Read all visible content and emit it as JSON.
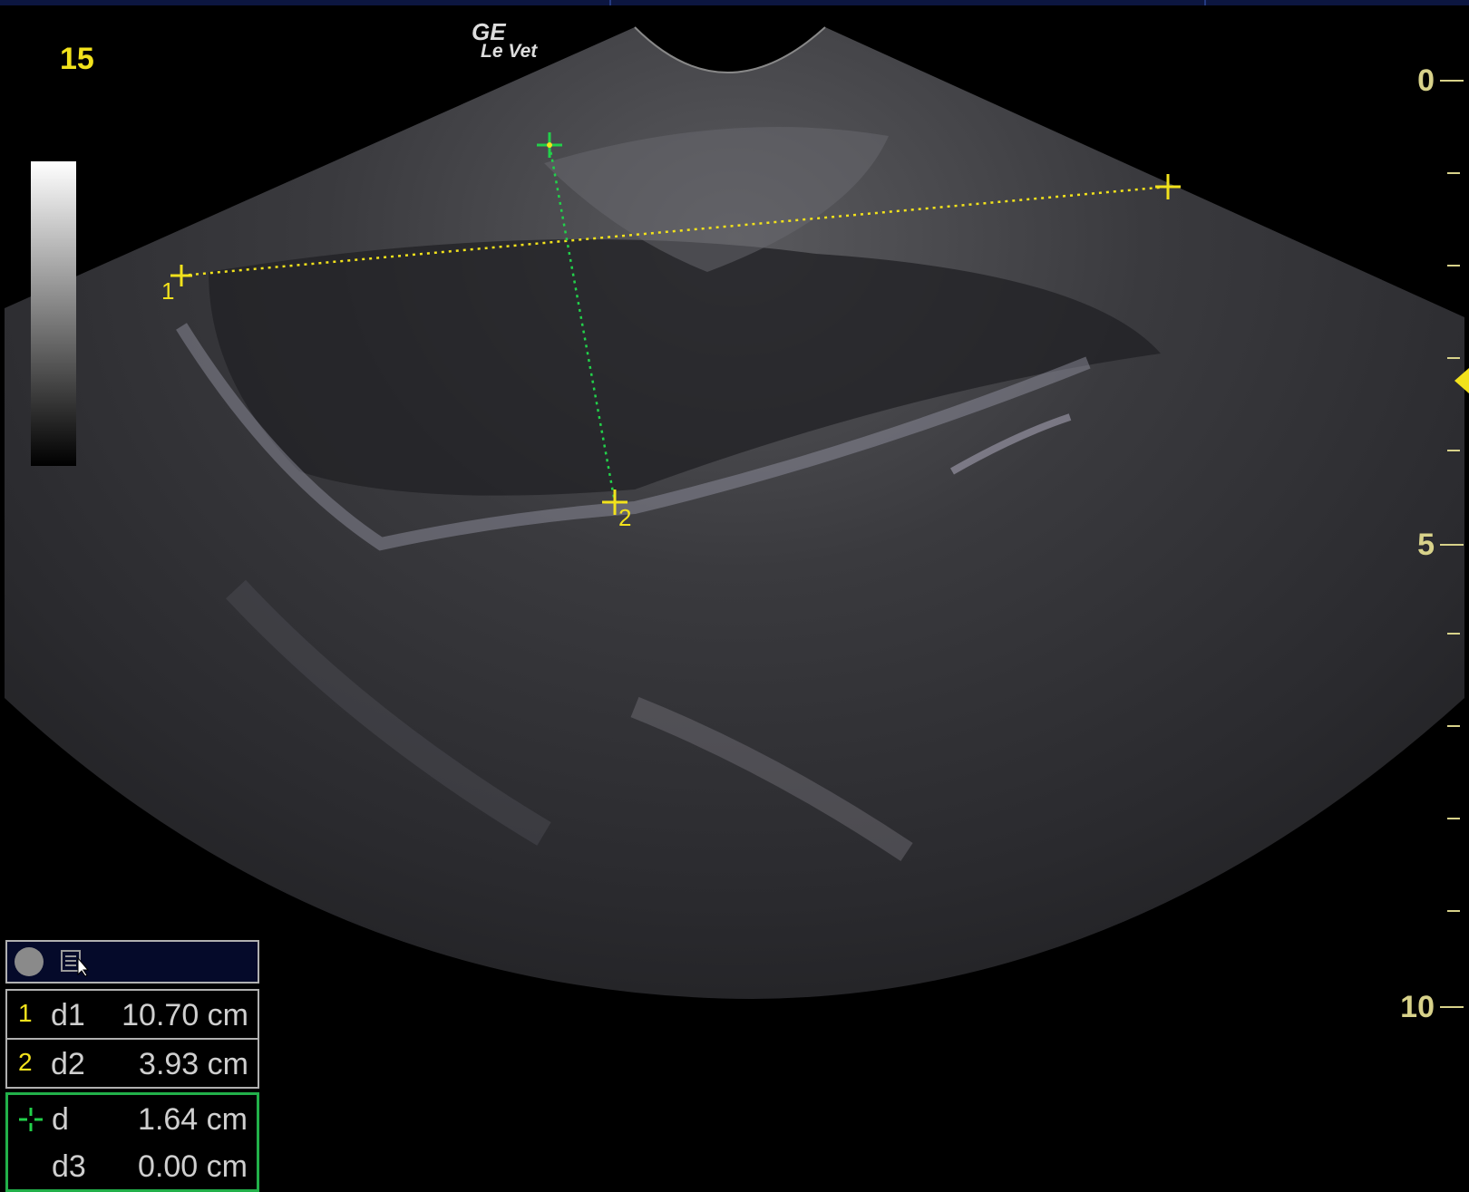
{
  "header": {
    "frame_number": "15",
    "logo_line1": "GE",
    "logo_line2": "Le Vet"
  },
  "depth_scale": {
    "labels": [
      "0",
      "5",
      "10"
    ],
    "tick_mark": "-"
  },
  "markers": {
    "d1_start": "1",
    "d2_end": "2"
  },
  "measurements": [
    {
      "index": "1",
      "label": "d1",
      "value": "10.70 cm"
    },
    {
      "index": "2",
      "label": "d2",
      "value": "3.93 cm"
    }
  ],
  "active_measurement": [
    {
      "label": "d",
      "value": "1.64 cm"
    },
    {
      "label": "d3",
      "value": "0.00 cm"
    }
  ],
  "colors": {
    "caliper_yellow": "#f2e21c",
    "caliper_green": "#22d04a",
    "panel_border": "#b0b0b0"
  }
}
